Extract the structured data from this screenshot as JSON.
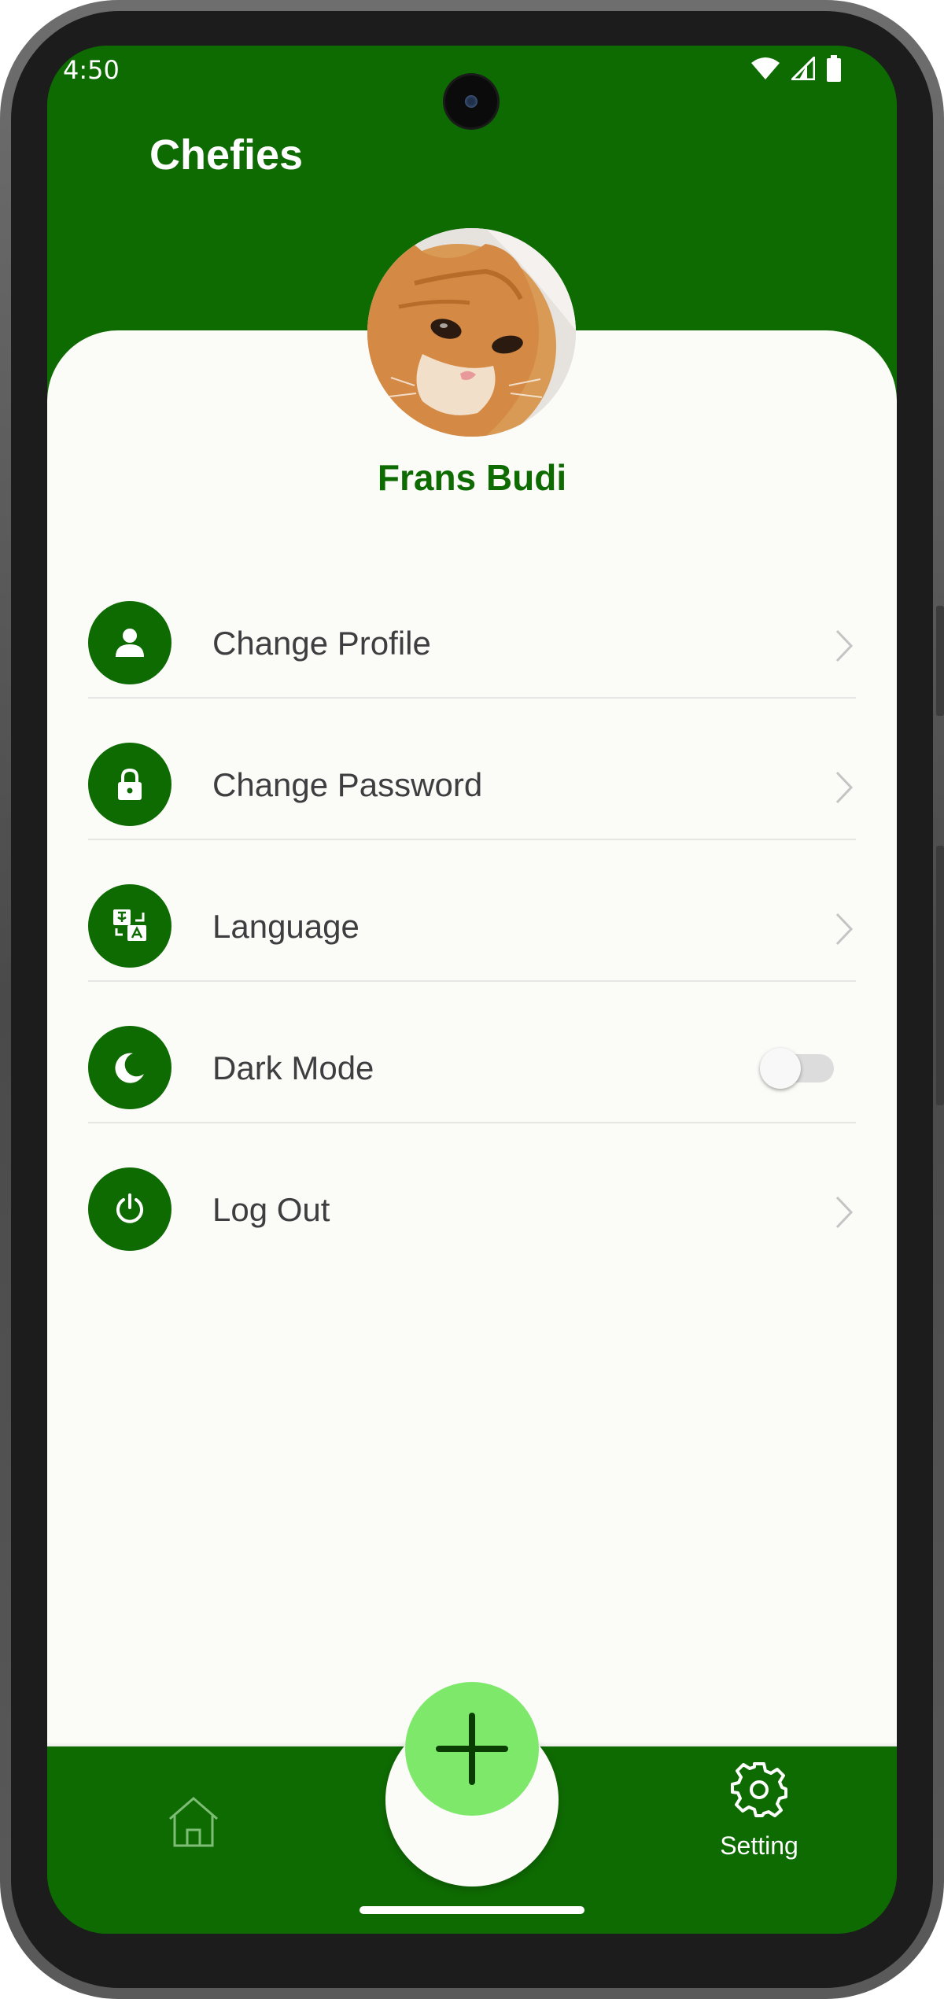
{
  "status_bar": {
    "time": "4:50",
    "icons": [
      "wifi-icon",
      "signal-icon",
      "battery-icon"
    ]
  },
  "header": {
    "app_title": "Chefies"
  },
  "profile": {
    "name": "Frans Budi",
    "avatar": "cat-photo"
  },
  "menu": {
    "items": [
      {
        "label": "Change Profile",
        "icon": "person-icon",
        "trailing": "chevron"
      },
      {
        "label": "Change Password",
        "icon": "lock-icon",
        "trailing": "chevron"
      },
      {
        "label": "Language",
        "icon": "translate-icon",
        "trailing": "chevron"
      },
      {
        "label": "Dark Mode",
        "icon": "moon-icon",
        "trailing": "toggle",
        "toggle_on": false
      },
      {
        "label": "Log Out",
        "icon": "power-icon",
        "trailing": "chevron"
      }
    ]
  },
  "bottom_nav": {
    "home_icon": "home-icon",
    "fab_icon": "plus-icon",
    "setting_label": "Setting",
    "setting_icon": "gear-icon"
  },
  "colors": {
    "primary": "#0e6b02",
    "accent": "#7de86a",
    "background": "#fbfbf8",
    "text": "#3e3e40"
  }
}
